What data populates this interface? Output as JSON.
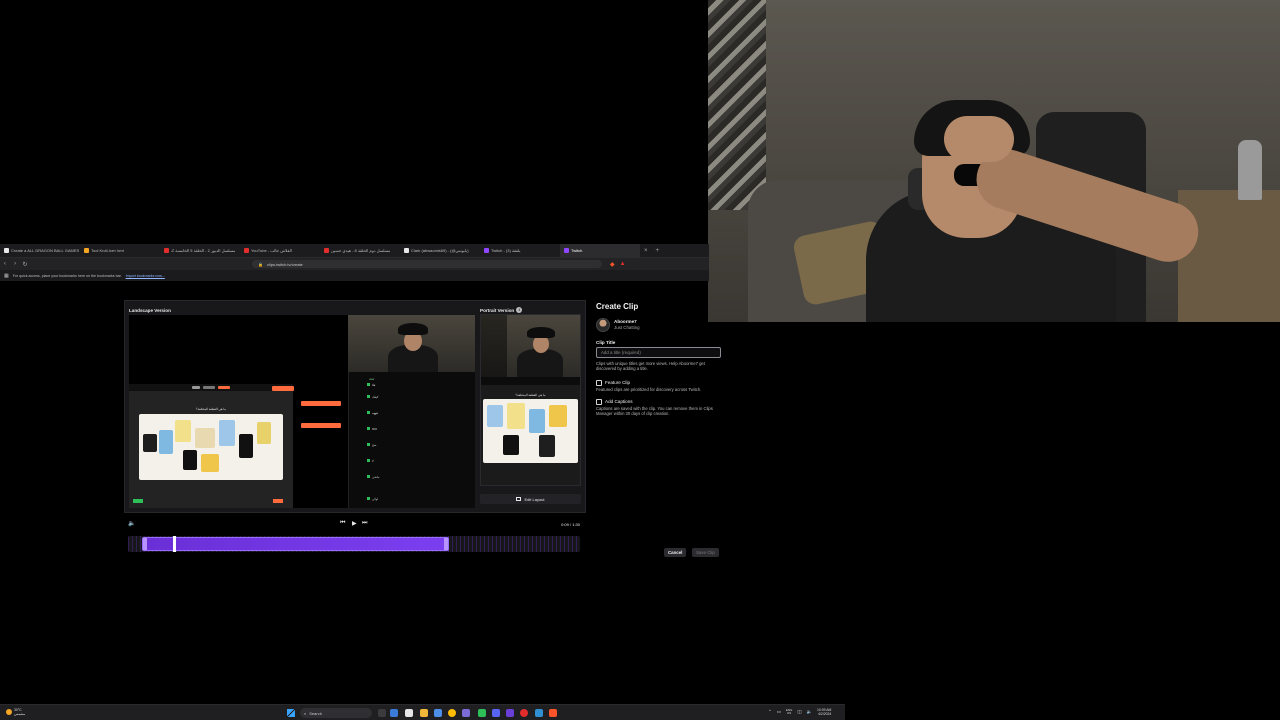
{
  "browser": {
    "tabs": [
      {
        "label": "Create a ALL DRAGON BALL GAMES",
        "color": "#e8e8e8"
      },
      {
        "label": "Tool Kroll-Iceт hmt",
        "color": "#f5a623"
      },
      {
        "label": "مسلسل الدبور 2 - الحلقة 5 الخامسة كـ",
        "color": "#e22d2d"
      },
      {
        "label": "YouTube - الفلاش جالب",
        "color": "#e22d2d"
      },
      {
        "label": "مسلسل دوم الحلقة 8 - هيدي حسين",
        "color": "#e22d2d"
      },
      {
        "label": "Clark (abwaomis69) - (@بابونس)",
        "color": "#e8e8e8"
      },
      {
        "label": "Twitch - (3) بلفقة",
        "color": "#9147ff"
      },
      {
        "label": "Twitch",
        "color": "#9147ff"
      }
    ],
    "url": "clips.twitch.tv/create",
    "bookmarks_hint": "For quick access, place your bookmarks here on the bookmarks bar.",
    "bookmarks_link": "Import bookmarks now..."
  },
  "editor": {
    "landscape_label": "Landscape Version",
    "portrait_label": "Portrait Version",
    "edit_layout_label": "Edit Layout",
    "time_readout": "0:09 / 1:30",
    "clip_start_fraction": 0.03,
    "clip_end_fraction": 0.71,
    "playhead_fraction": 0.1
  },
  "form": {
    "title": "Create Clip",
    "channel": "Aboorme7",
    "category": "Just Chatting",
    "title_label": "Clip Title",
    "title_placeholder": "Add a title (required)",
    "title_help": "Clips with unique titles get more views. Help Aboorme7 get discovered by adding a title.",
    "feature_label": "Feature Clip",
    "feature_help": "Featured clips are prioritized for discovery across Twitch.",
    "captions_label": "Add Captions",
    "captions_help": "Captions are saved with the clip. You can remove them in Clips Manager within 30 days of clip creation.",
    "cancel_label": "Cancel",
    "save_label": "Save Clip"
  },
  "taskbar": {
    "weather_temp": "30°C",
    "weather_desc": "مشمس",
    "search_placeholder": "Search",
    "lang_top": "ENG",
    "lang_bottom": "US",
    "time": "10:09 AM",
    "date": "4/2/2024"
  },
  "icons": {
    "vol": "volume-icon",
    "play": "play-icon"
  }
}
